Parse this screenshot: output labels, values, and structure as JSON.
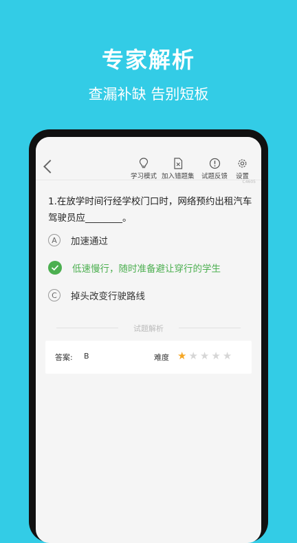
{
  "promo": {
    "title": "专家解析",
    "subtitle": "查漏补缺 告别短板"
  },
  "toolbar": {
    "items": [
      {
        "label": "学习模式",
        "icon": "lightbulb-icon"
      },
      {
        "label": "加入错题集",
        "icon": "wrong-set-icon"
      },
      {
        "label": "试题反馈",
        "icon": "feedback-icon"
      },
      {
        "label": "设置",
        "icon": "gear-icon"
      }
    ]
  },
  "question": {
    "id_code": "C4605",
    "text": "1.在放学时间行经学校门口时，网络预约出租汽车驾驶员应________。",
    "options": [
      {
        "letter": "A",
        "text": "加速通过",
        "state": "normal"
      },
      {
        "letter": "B",
        "text": "低速慢行，随时准备避让穿行的学生",
        "state": "correct"
      },
      {
        "letter": "C",
        "text": "掉头改变行驶路线",
        "state": "normal"
      }
    ]
  },
  "analysis": {
    "section_title": "试题解析",
    "answer_label": "答案:",
    "answer_value": "B",
    "difficulty_label": "难度",
    "difficulty_rating": 1,
    "difficulty_max": 5
  },
  "colors": {
    "background": "#33CCE6",
    "correct": "#4CAF50",
    "star_on": "#F5A623",
    "star_off": "#D6D6D6"
  }
}
